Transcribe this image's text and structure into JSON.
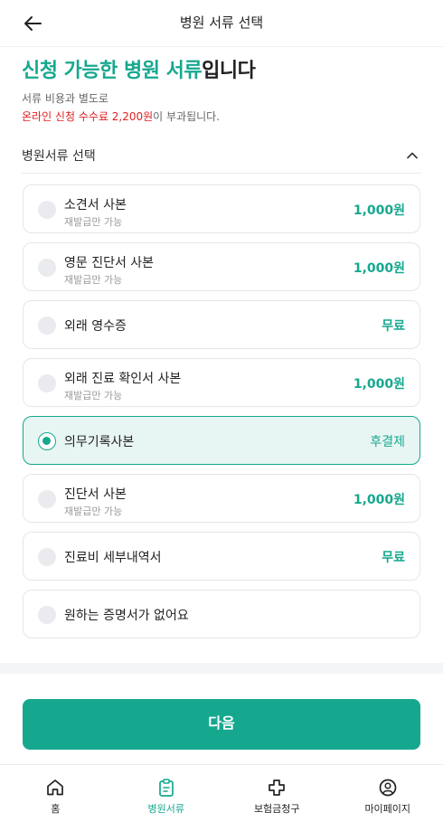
{
  "header": {
    "title": "병원 서류 선택",
    "back_icon": "arrow-left-icon"
  },
  "intro": {
    "headline_accent": "신청 가능한 병원 서류",
    "headline_rest": "입니다",
    "line1": "서류 비용과 별도로",
    "line2_red": "온라인 신청 수수료 2,200원",
    "line2_rest": "이 부과됩니다."
  },
  "section": {
    "title": "병원서류 선택",
    "expanded": true
  },
  "documents": [
    {
      "name": "소견서 사본",
      "note": "재발급만 가능",
      "price": "1,000원",
      "selected": false
    },
    {
      "name": "영문 진단서 사본",
      "note": "재발급만 가능",
      "price": "1,000원",
      "selected": false
    },
    {
      "name": "외래 영수증",
      "note": "",
      "price": "무료",
      "selected": false
    },
    {
      "name": "외래 진료 확인서 사본",
      "note": "재발급만 가능",
      "price": "1,000원",
      "selected": false
    },
    {
      "name": "의무기록사본",
      "note": "",
      "price": "후결제",
      "selected": true
    },
    {
      "name": "진단서 사본",
      "note": "재발급만 가능",
      "price": "1,000원",
      "selected": false
    },
    {
      "name": "진료비 세부내역서",
      "note": "",
      "price": "무료",
      "selected": false
    },
    {
      "name": "원하는 증명서가 없어요",
      "note": "",
      "price": "",
      "selected": false
    }
  ],
  "next_button": {
    "label": "다음"
  },
  "tabbar": {
    "active": 1,
    "tabs": [
      {
        "label": "홈",
        "icon": "home-icon"
      },
      {
        "label": "병원서류",
        "icon": "clipboard-icon"
      },
      {
        "label": "보험금청구",
        "icon": "plus-cross-icon"
      },
      {
        "label": "마이페이지",
        "icon": "user-icon"
      }
    ]
  },
  "colors": {
    "accent": "#16a88f",
    "warning": "#e02020"
  }
}
